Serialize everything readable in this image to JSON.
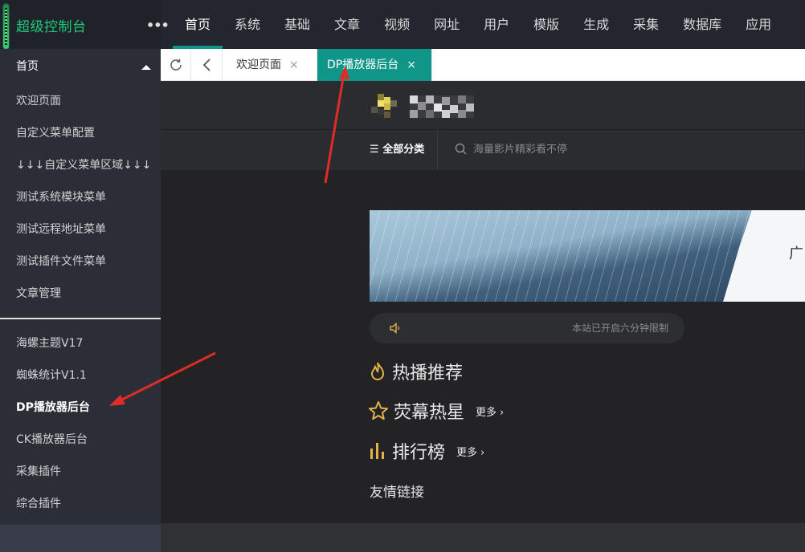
{
  "app": {
    "title": "超级控制台",
    "more": "•••"
  },
  "topnav": {
    "items": [
      {
        "label": "首页",
        "active": true
      },
      {
        "label": "系统"
      },
      {
        "label": "基础"
      },
      {
        "label": "文章"
      },
      {
        "label": "视频"
      },
      {
        "label": "网址"
      },
      {
        "label": "用户"
      },
      {
        "label": "模版"
      },
      {
        "label": "生成"
      },
      {
        "label": "采集"
      },
      {
        "label": "数据库"
      },
      {
        "label": "应用"
      }
    ]
  },
  "sidebar": {
    "head": "首页",
    "group1": [
      "欢迎页面",
      "自定义菜单配置",
      "↓↓↓自定义菜单区域↓↓↓",
      "测试系统模块菜单",
      "测试远程地址菜单",
      "测试插件文件菜单",
      "文章管理"
    ],
    "group2": [
      "海螺主题V17",
      "蜘蛛统计V1.1",
      "DP播放器后台",
      "CK播放器后台",
      "采集插件",
      "综合插件"
    ]
  },
  "tabs": [
    {
      "label": "欢迎页面",
      "close": "×"
    },
    {
      "label": "DP播放器后台",
      "close": "×",
      "active": true
    }
  ],
  "site": {
    "allcat": "全部分类",
    "search_placeholder": "海量影片精彩看不停",
    "banner_char": "广",
    "notice": "本站已开启六分钟限制",
    "sections": [
      {
        "title": "热播推荐",
        "icon": "flame-icon"
      },
      {
        "title": "荧幕热星",
        "icon": "star-icon",
        "more": "更多"
      },
      {
        "title": "排行榜",
        "icon": "bar-chart-icon",
        "more": "更多"
      }
    ],
    "links": "友情链接"
  },
  "colors": {
    "accent": "#0f9688",
    "brand_green": "#1ec97a",
    "icon_gold": "#e3b24d",
    "annotation_red": "#e02b27"
  }
}
